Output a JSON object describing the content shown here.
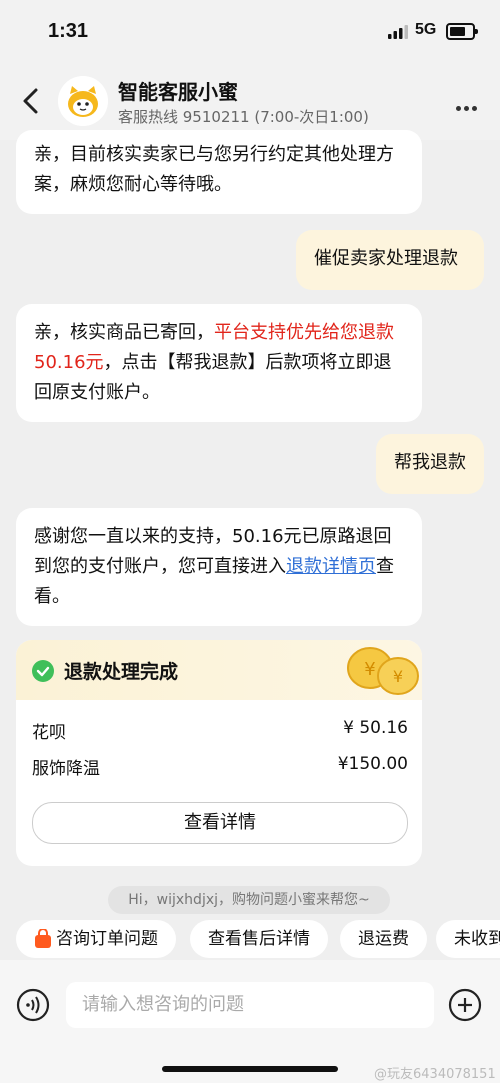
{
  "status_bar": {
    "time": "1:31",
    "network": "5G"
  },
  "header": {
    "title": "智能客服小蜜",
    "subtitle": "客服热线 9510211 (7:00-次日1:00)"
  },
  "messages": {
    "m1": {
      "text": "亲，目前核实卖家已与您另行约定其他处理方案，麻烦您耐心等待哦。"
    },
    "m2": {
      "text": "催促卖家处理退款"
    },
    "m3": {
      "before": "亲，核实商品已寄回，",
      "highlight": "平台支持优先给您退款50.16元",
      "after": "，点击【帮我退款】后款项将立即退回原支付账户。"
    },
    "m4": {
      "text": "帮我退款"
    },
    "m5": {
      "before": "感谢您一直以来的支持，50.16元已原路退回到您的支付账户，您可直接进入",
      "link": "退款详情页",
      "after": "查看。"
    }
  },
  "refund_card": {
    "title": "退款处理完成",
    "rows": [
      {
        "label": "花呗",
        "currency": "¥",
        "amount": "50.16"
      },
      {
        "label": "服饰降温",
        "currency": "¥",
        "amount": "150.00"
      }
    ],
    "button": "查看详情"
  },
  "hint": "Hi，wijxhdjxj，购物问题小蜜来帮您~",
  "quick_replies": [
    "咨询订单问题",
    "查看售后详情",
    "退运费",
    "未收到"
  ],
  "input": {
    "placeholder": "请输入想咨询的问题"
  },
  "watermark": "@玩友6434078151",
  "colors": {
    "accent_red": "#e1251b",
    "link_blue": "#2f6fd6",
    "success_green": "#3fbf5a",
    "user_bubble": "#fdf4dd"
  }
}
